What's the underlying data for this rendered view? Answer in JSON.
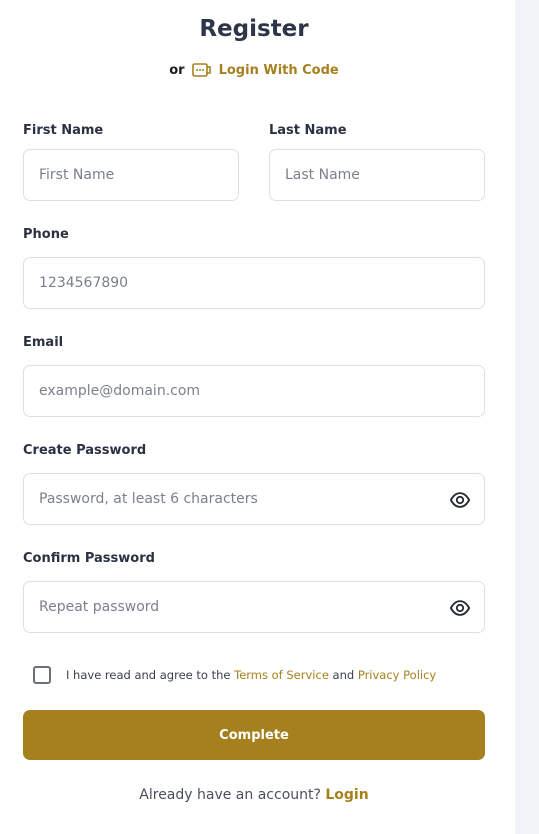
{
  "header": {
    "title": "Register",
    "or_text": "or",
    "alt_login_label": "Login With Code",
    "alt_login_icon": "code-icon"
  },
  "form": {
    "first_name": {
      "label": "First Name",
      "placeholder": "First Name",
      "value": ""
    },
    "last_name": {
      "label": "Last Name",
      "placeholder": "Last Name",
      "value": ""
    },
    "phone": {
      "label": "Phone",
      "placeholder": "1234567890",
      "value": ""
    },
    "email": {
      "label": "Email",
      "placeholder": "example@domain.com",
      "value": ""
    },
    "password": {
      "label": "Create Password",
      "placeholder": "Password, at least 6 characters",
      "value": "",
      "icon": "eye-icon"
    },
    "confirm_password": {
      "label": "Confirm Password",
      "placeholder": "Repeat password",
      "value": "",
      "icon": "eye-icon"
    }
  },
  "agreement": {
    "checked": false,
    "text_prefix": "I have read and agree to the",
    "terms_label": "Terms of Service",
    "and_text": "and",
    "privacy_label": "Privacy Policy"
  },
  "submit_label": "Complete",
  "footer": {
    "prompt": "Already have an account?",
    "login_label": "Login"
  },
  "colors": {
    "accent": "#a7801e",
    "title": "#2d3648",
    "border": "#dcdfe4",
    "side_panel": "#f1f3f6"
  }
}
